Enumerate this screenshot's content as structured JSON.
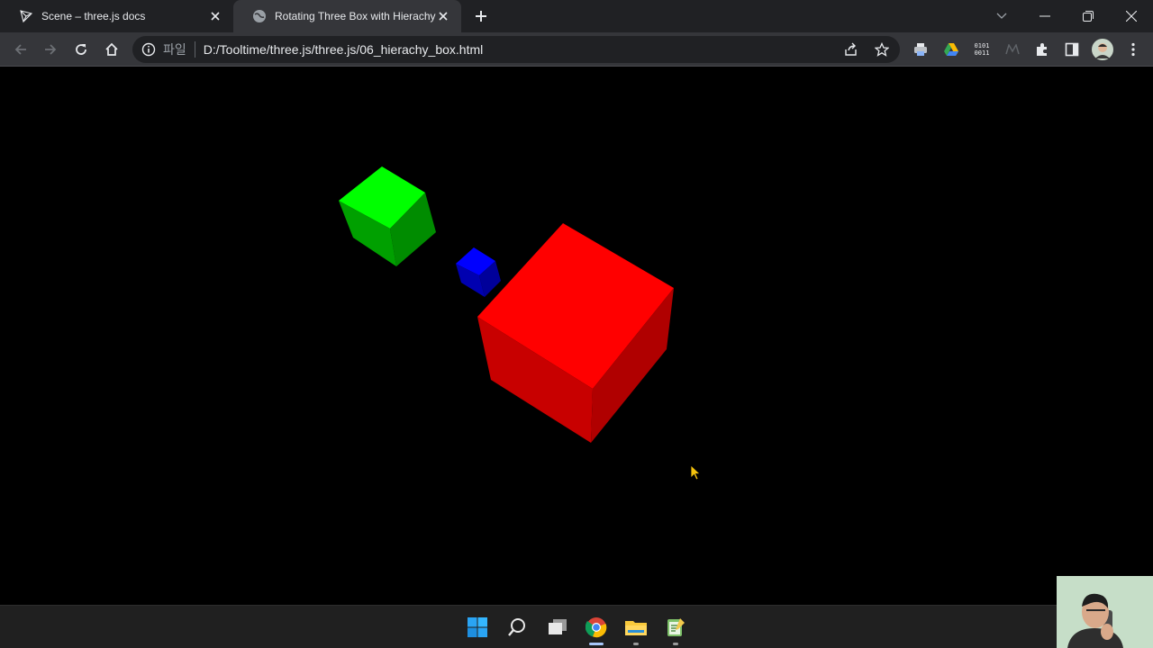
{
  "browser": {
    "tabs": [
      {
        "title": "Scene – three.js docs",
        "favicon": "threejs-icon",
        "active": false
      },
      {
        "title": "Rotating Three Box with Hierachy",
        "favicon": "globe-icon",
        "active": true
      }
    ],
    "address": {
      "scheme_label": "파일",
      "url": "D:/Tooltime/three.js/three.js/06_hierachy_box.html"
    },
    "extension_label": "0101\n0011"
  },
  "scene": {
    "background": "#000000",
    "cubes": [
      {
        "name": "green-cube",
        "color": "#00ff00"
      },
      {
        "name": "blue-cube",
        "color": "#0000ff"
      },
      {
        "name": "red-cube",
        "color": "#ff0000"
      }
    ]
  },
  "taskbar": {
    "items": [
      "start-icon",
      "search-icon",
      "task-view-icon",
      "chrome-icon",
      "file-explorer-icon",
      "notepad-icon"
    ]
  },
  "colors": {
    "tabstrip": "#202124",
    "toolbar": "#35363a",
    "taskbar": "#202020",
    "cursor": "#f4c20d"
  }
}
